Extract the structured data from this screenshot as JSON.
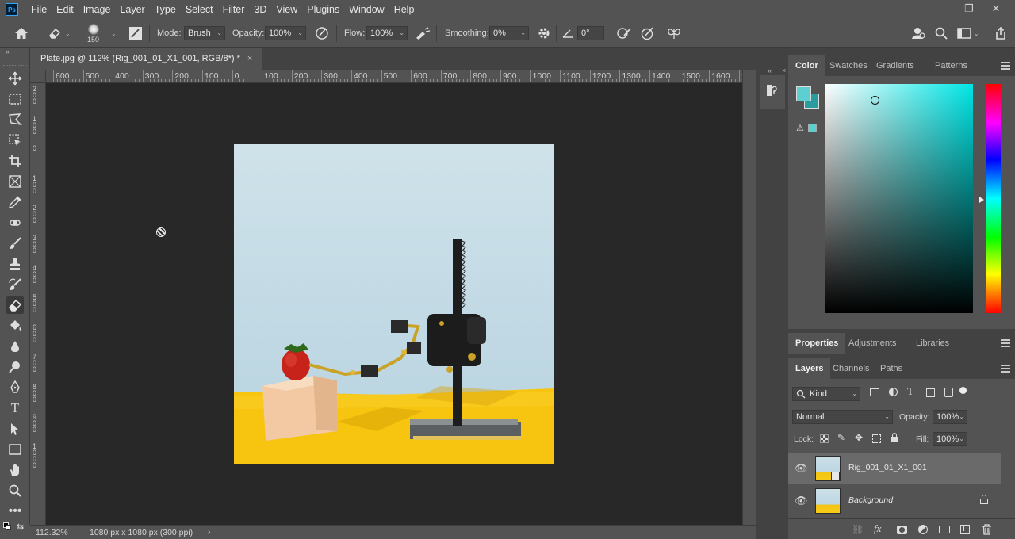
{
  "app": {
    "logo": "Ps"
  },
  "menu": [
    "File",
    "Edit",
    "Image",
    "Layer",
    "Type",
    "Select",
    "Filter",
    "3D",
    "View",
    "Plugins",
    "Window",
    "Help"
  ],
  "window_controls": {
    "minimize": "—",
    "restore": "❐",
    "close": "✕"
  },
  "options": {
    "brush_size": "150",
    "mode_label": "Mode:",
    "mode_value": "Brush",
    "opacity_label": "Opacity:",
    "opacity_value": "100%",
    "flow_label": "Flow:",
    "flow_value": "100%",
    "smoothing_label": "Smoothing:",
    "smoothing_value": "0%",
    "angle_value": "0°"
  },
  "document": {
    "tab_title": "Plate.jpg @ 112% (Rig_001_01_X1_001, RGB/8*) *",
    "tab_close": "×"
  },
  "ruler_top": [
    "600",
    "500",
    "400",
    "300",
    "200",
    "100",
    "0",
    "100",
    "200",
    "300",
    "400",
    "500",
    "600",
    "700",
    "800",
    "900",
    "1000",
    "1100",
    "1200",
    "1300",
    "1400",
    "1500",
    "1600",
    "1"
  ],
  "ruler_left": [
    "2 0 0",
    "1 0 0",
    "0",
    "1 0 0",
    "2 0 0",
    "3 0 0",
    "4 0 0",
    "5 0 0",
    "6 0 0",
    "7 0 0",
    "8 0 0",
    "9 0 0",
    "1 0 0 0"
  ],
  "status": {
    "zoom": "112.32%",
    "doc_info": "1080 px x 1080 px (300 ppi)",
    "more": "›"
  },
  "color_panel": {
    "tabs": [
      "Color",
      "Swatches",
      "Gradients",
      "Patterns"
    ],
    "foreground": "#5ecfd0",
    "background": "#2a9ca0",
    "hue": "#00e6e6"
  },
  "properties_panel": {
    "tabs": [
      "Properties",
      "Adjustments",
      "Libraries"
    ]
  },
  "layers_panel": {
    "tabs": [
      "Layers",
      "Channels",
      "Paths"
    ],
    "filter_label": "Kind",
    "blend_mode": "Normal",
    "opacity_label": "Opacity:",
    "opacity_value": "100%",
    "lock_label": "Lock:",
    "fill_label": "Fill:",
    "fill_value": "100%",
    "layers": [
      {
        "name": "Rig_001_01_X1_001",
        "selected": true,
        "locked": false
      },
      {
        "name": "Background",
        "selected": false,
        "locked": true
      }
    ]
  }
}
